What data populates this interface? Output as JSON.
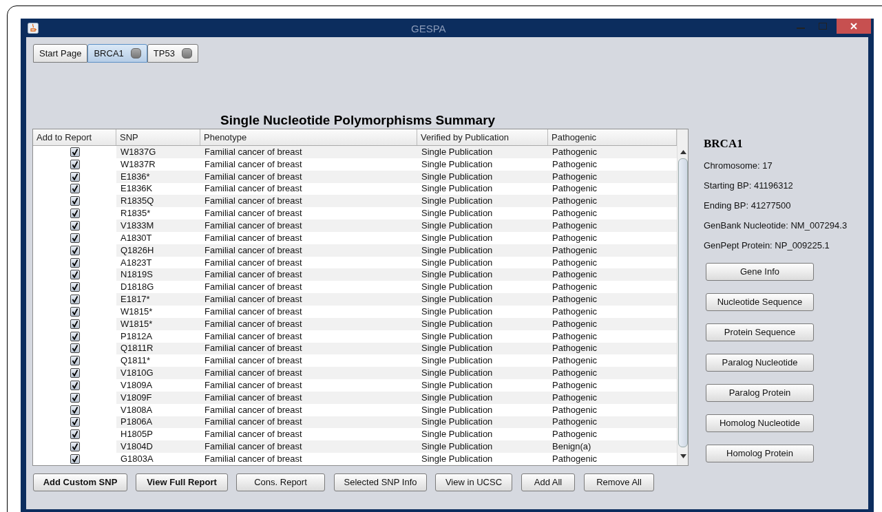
{
  "window": {
    "title": "GESPA"
  },
  "tabs": [
    {
      "label": "Start Page",
      "selected": false,
      "closable": false
    },
    {
      "label": "BRCA1",
      "selected": true,
      "closable": true
    },
    {
      "label": "TP53",
      "selected": false,
      "closable": true
    }
  ],
  "heading": "Single Nucleotide Polymorphisms Summary",
  "table": {
    "columns": [
      "Add to Report",
      "SNP",
      "Phenotype",
      "Verified by Publication",
      "Pathogenic"
    ],
    "rows": [
      {
        "checked": true,
        "snp": "W1837G",
        "phenotype": "Familial cancer of breast",
        "verified": "Single Publication",
        "pathogenic": "Pathogenic"
      },
      {
        "checked": true,
        "snp": "W1837R",
        "phenotype": "Familial cancer of breast",
        "verified": "Single Publication",
        "pathogenic": "Pathogenic"
      },
      {
        "checked": true,
        "snp": "E1836*",
        "phenotype": "Familial cancer of breast",
        "verified": "Single Publication",
        "pathogenic": "Pathogenic"
      },
      {
        "checked": true,
        "snp": "E1836K",
        "phenotype": "Familial cancer of breast",
        "verified": "Single Publication",
        "pathogenic": "Pathogenic"
      },
      {
        "checked": true,
        "snp": "R1835Q",
        "phenotype": "Familial cancer of breast",
        "verified": "Single Publication",
        "pathogenic": "Pathogenic"
      },
      {
        "checked": true,
        "snp": "R1835*",
        "phenotype": "Familial cancer of breast",
        "verified": "Single Publication",
        "pathogenic": "Pathogenic"
      },
      {
        "checked": true,
        "snp": "V1833M",
        "phenotype": "Familial cancer of breast",
        "verified": "Single Publication",
        "pathogenic": "Pathogenic"
      },
      {
        "checked": true,
        "snp": "A1830T",
        "phenotype": "Familial cancer of breast",
        "verified": "Single Publication",
        "pathogenic": "Pathogenic"
      },
      {
        "checked": true,
        "snp": "Q1826H",
        "phenotype": "Familial cancer of breast",
        "verified": "Single Publication",
        "pathogenic": "Pathogenic"
      },
      {
        "checked": true,
        "snp": "A1823T",
        "phenotype": "Familial cancer of breast",
        "verified": "Single Publication",
        "pathogenic": "Pathogenic"
      },
      {
        "checked": true,
        "snp": "N1819S",
        "phenotype": "Familial cancer of breast",
        "verified": "Single Publication",
        "pathogenic": "Pathogenic"
      },
      {
        "checked": true,
        "snp": "D1818G",
        "phenotype": "Familial cancer of breast",
        "verified": "Single Publication",
        "pathogenic": "Pathogenic"
      },
      {
        "checked": true,
        "snp": "E1817*",
        "phenotype": "Familial cancer of breast",
        "verified": "Single Publication",
        "pathogenic": "Pathogenic"
      },
      {
        "checked": true,
        "snp": "W1815*",
        "phenotype": "Familial cancer of breast",
        "verified": "Single Publication",
        "pathogenic": "Pathogenic"
      },
      {
        "checked": true,
        "snp": "W1815*",
        "phenotype": "Familial cancer of breast",
        "verified": "Single Publication",
        "pathogenic": "Pathogenic"
      },
      {
        "checked": true,
        "snp": "P1812A",
        "phenotype": "Familial cancer of breast",
        "verified": "Single Publication",
        "pathogenic": "Pathogenic"
      },
      {
        "checked": true,
        "snp": "Q1811R",
        "phenotype": "Familial cancer of breast",
        "verified": "Single Publication",
        "pathogenic": "Pathogenic"
      },
      {
        "checked": true,
        "snp": "Q1811*",
        "phenotype": "Familial cancer of breast",
        "verified": "Single Publication",
        "pathogenic": "Pathogenic"
      },
      {
        "checked": true,
        "snp": "V1810G",
        "phenotype": "Familial cancer of breast",
        "verified": "Single Publication",
        "pathogenic": "Pathogenic"
      },
      {
        "checked": true,
        "snp": "V1809A",
        "phenotype": "Familial cancer of breast",
        "verified": "Single Publication",
        "pathogenic": "Pathogenic"
      },
      {
        "checked": true,
        "snp": "V1809F",
        "phenotype": "Familial cancer of breast",
        "verified": "Single Publication",
        "pathogenic": "Pathogenic"
      },
      {
        "checked": true,
        "snp": "V1808A",
        "phenotype": "Familial cancer of breast",
        "verified": "Single Publication",
        "pathogenic": "Pathogenic"
      },
      {
        "checked": true,
        "snp": "P1806A",
        "phenotype": "Familial cancer of breast",
        "verified": "Single Publication",
        "pathogenic": "Pathogenic"
      },
      {
        "checked": true,
        "snp": "H1805P",
        "phenotype": "Familial cancer of breast",
        "verified": "Single Publication",
        "pathogenic": "Pathogenic"
      },
      {
        "checked": true,
        "snp": "V1804D",
        "phenotype": "Familial cancer of breast",
        "verified": "Single Publication",
        "pathogenic": "Benign(a)"
      },
      {
        "checked": true,
        "snp": "G1803A",
        "phenotype": "Familial cancer of breast",
        "verified": "Single Publication",
        "pathogenic": "Pathogenic"
      }
    ]
  },
  "gene_panel": {
    "name": "BRCA1",
    "info": [
      "Chromosome: 17",
      "Starting BP: 41196312",
      "Ending BP: 41277500",
      "GenBank Nucleotide: NM_007294.3",
      "GenPept Protein: NP_009225.1"
    ],
    "buttons": [
      "Gene Info",
      "Nucleotide Sequence",
      "Protein Sequence",
      "Paralog Nucleotide",
      "Paralog Protein",
      "Homolog Nucleotide",
      "Homolog Protein"
    ]
  },
  "bottom_buttons": [
    {
      "label": "Add Custom SNP",
      "bold": true
    },
    {
      "label": "View Full Report",
      "bold": true
    },
    {
      "label": "Cons. Report",
      "bold": false
    },
    {
      "label": "Selected SNP Info",
      "bold": false
    },
    {
      "label": "View in UCSC",
      "bold": false
    },
    {
      "label": "Add All",
      "bold": false
    },
    {
      "label": "Remove All",
      "bold": false
    }
  ]
}
